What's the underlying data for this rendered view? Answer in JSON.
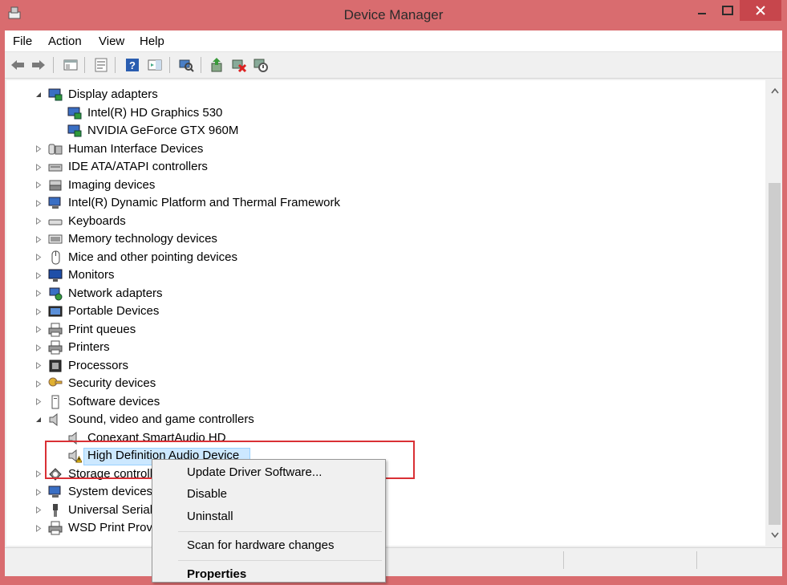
{
  "window": {
    "title": "Device Manager"
  },
  "menubar": {
    "items": [
      "File",
      "Action",
      "View",
      "Help"
    ]
  },
  "toolbar": {
    "buttons": [
      "back-icon",
      "forward-icon",
      "show-hide-console-tree-icon",
      "properties-icon",
      "help-icon",
      "action-pane-icon",
      "scan-hardware-icon",
      "update-driver-icon",
      "uninstall-device-icon",
      "disable-device-icon"
    ]
  },
  "tree": {
    "items": [
      {
        "label": "Display adapters",
        "level": 0,
        "expander": "expanded",
        "icon": "display-adapter-icon"
      },
      {
        "label": "Intel(R) HD Graphics 530",
        "level": 1,
        "expander": "none",
        "icon": "display-adapter-icon"
      },
      {
        "label": "NVIDIA GeForce GTX 960M",
        "level": 1,
        "expander": "none",
        "icon": "display-adapter-icon"
      },
      {
        "label": "Human Interface Devices",
        "level": 0,
        "expander": "collapsed",
        "icon": "hid-icon"
      },
      {
        "label": "IDE ATA/ATAPI controllers",
        "level": 0,
        "expander": "collapsed",
        "icon": "ide-controller-icon"
      },
      {
        "label": "Imaging devices",
        "level": 0,
        "expander": "collapsed",
        "icon": "imaging-device-icon"
      },
      {
        "label": "Intel(R) Dynamic Platform and Thermal Framework",
        "level": 0,
        "expander": "collapsed",
        "icon": "computer-icon"
      },
      {
        "label": "Keyboards",
        "level": 0,
        "expander": "collapsed",
        "icon": "keyboard-icon"
      },
      {
        "label": "Memory technology devices",
        "level": 0,
        "expander": "collapsed",
        "icon": "memory-device-icon"
      },
      {
        "label": "Mice and other pointing devices",
        "level": 0,
        "expander": "collapsed",
        "icon": "mouse-icon"
      },
      {
        "label": "Monitors",
        "level": 0,
        "expander": "collapsed",
        "icon": "monitor-icon"
      },
      {
        "label": "Network adapters",
        "level": 0,
        "expander": "collapsed",
        "icon": "network-adapter-icon"
      },
      {
        "label": "Portable Devices",
        "level": 0,
        "expander": "collapsed",
        "icon": "portable-device-icon"
      },
      {
        "label": "Print queues",
        "level": 0,
        "expander": "collapsed",
        "icon": "printer-icon"
      },
      {
        "label": "Printers",
        "level": 0,
        "expander": "collapsed",
        "icon": "printer-icon"
      },
      {
        "label": "Processors",
        "level": 0,
        "expander": "collapsed",
        "icon": "processor-icon"
      },
      {
        "label": "Security devices",
        "level": 0,
        "expander": "collapsed",
        "icon": "security-key-icon"
      },
      {
        "label": "Software devices",
        "level": 0,
        "expander": "collapsed",
        "icon": "software-device-icon"
      },
      {
        "label": "Sound, video and game controllers",
        "level": 0,
        "expander": "expanded",
        "icon": "speaker-icon"
      },
      {
        "label": "Conexant SmartAudio HD",
        "level": 1,
        "expander": "none",
        "icon": "speaker-icon"
      },
      {
        "label": "High Definition Audio Device",
        "level": 1,
        "expander": "none",
        "icon": "warning-speaker-icon",
        "selected": true
      },
      {
        "label": "Storage controllers",
        "level": 0,
        "expander": "collapsed",
        "icon": "storage-controller-icon"
      },
      {
        "label": "System devices",
        "level": 0,
        "expander": "collapsed",
        "icon": "computer-icon"
      },
      {
        "label": "Universal Serial Bus controllers",
        "level": 0,
        "expander": "collapsed",
        "icon": "usb-icon"
      },
      {
        "label": "WSD Print Provider",
        "level": 0,
        "expander": "collapsed",
        "icon": "printer-icon"
      }
    ]
  },
  "context_menu": {
    "items": [
      {
        "label": "Update Driver Software...",
        "bold": false
      },
      {
        "label": "Disable",
        "bold": false
      },
      {
        "label": "Uninstall",
        "bold": false
      },
      {
        "label": "Scan for hardware changes",
        "bold": false
      },
      {
        "label": "Properties",
        "bold": true
      }
    ]
  },
  "colors": {
    "titlebar": "#d96c6f",
    "close_button": "#c7464c",
    "selection": "#cce8ff",
    "highlight_box": "#d93035"
  }
}
